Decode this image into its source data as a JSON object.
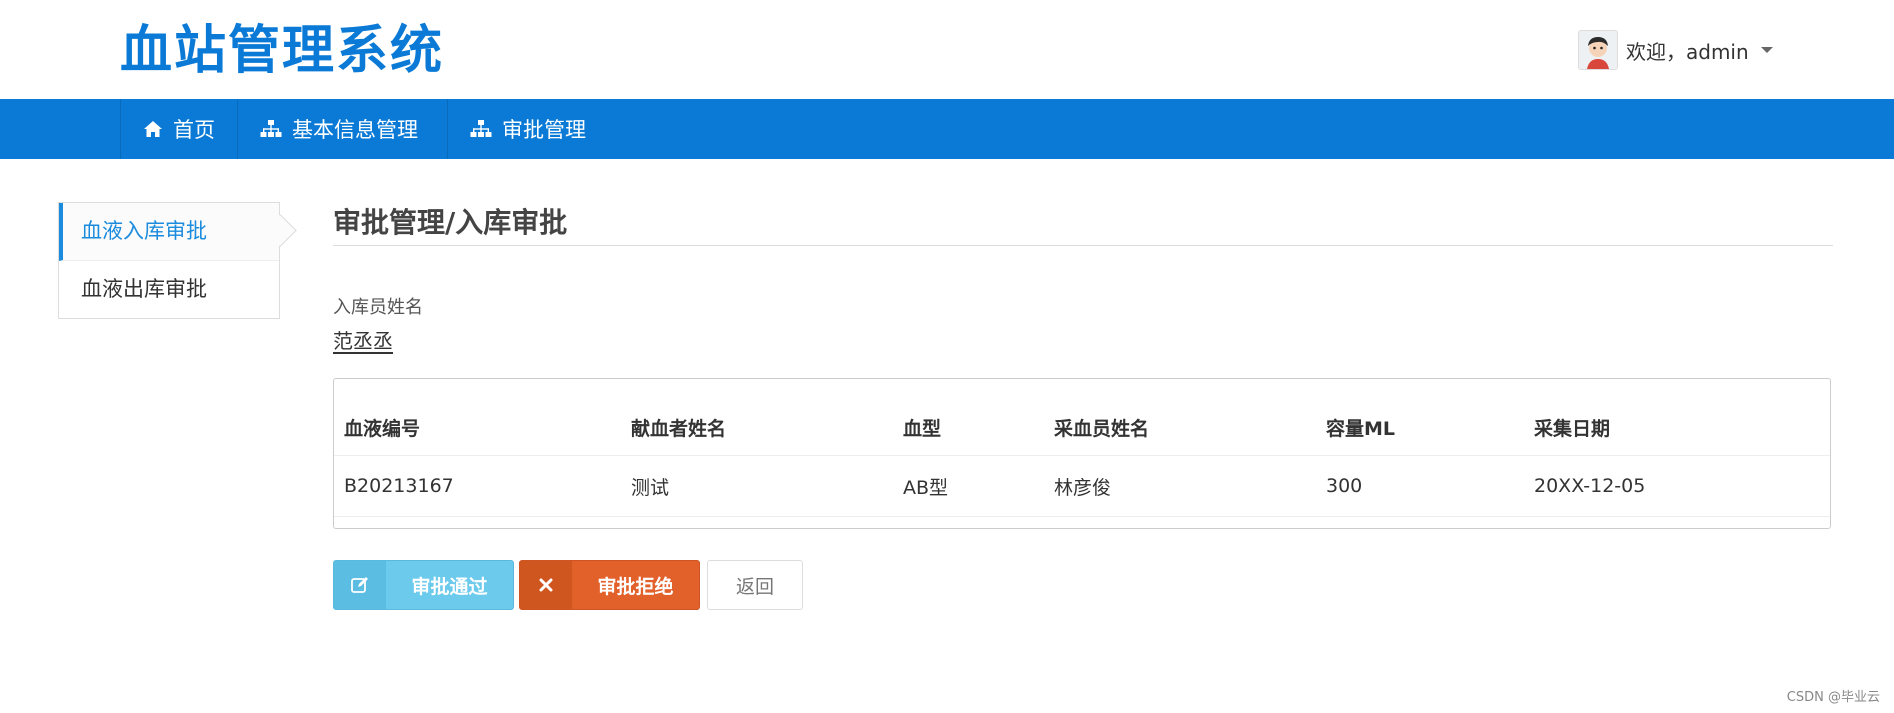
{
  "app": {
    "logo_text": "血站管理系统"
  },
  "user": {
    "greeting": "欢迎，admin"
  },
  "nav": {
    "items": [
      {
        "label": "首页",
        "icon": "home-icon"
      },
      {
        "label": "基本信息管理",
        "icon": "sitemap-icon"
      },
      {
        "label": "审批管理",
        "icon": "sitemap-icon"
      }
    ]
  },
  "sidebar": {
    "items": [
      {
        "label": "血液入库审批",
        "active": true
      },
      {
        "label": "血液出库审批",
        "active": false
      }
    ]
  },
  "page": {
    "title": "审批管理/入库审批",
    "field_label": "入库员姓名",
    "field_value": "范丞丞"
  },
  "table": {
    "headers": [
      "血液编号",
      "献血者姓名",
      "血型",
      "采血员姓名",
      "容量ML",
      "采集日期"
    ],
    "rows": [
      [
        "B20213167",
        "测试",
        "AB型",
        "林彦俊",
        "300",
        "20XX-12-05"
      ]
    ]
  },
  "buttons": {
    "approve_label": "审批通过",
    "reject_label": "审批拒绝",
    "back_label": "返回"
  },
  "watermark": "CSDN @毕业云",
  "colors": {
    "brand": "#0a7ad6",
    "approve": "#6ccbec",
    "reject": "#e2602a"
  }
}
